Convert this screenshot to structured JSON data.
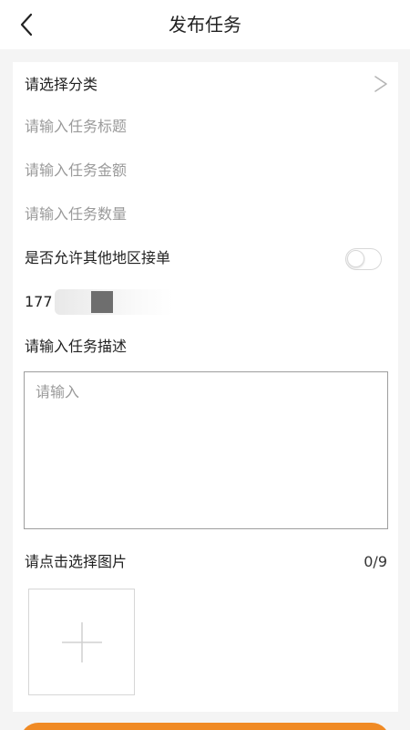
{
  "header": {
    "title": "发布任务",
    "back_icon": "chevron-left-icon"
  },
  "form": {
    "category_label": "请选择分类",
    "title_placeholder": "请输入任务标题",
    "amount_placeholder": "请输入任务金额",
    "quantity_placeholder": "请输入任务数量",
    "allow_other_regions_label": "是否允许其他地区接单",
    "allow_other_regions_enabled": false,
    "phone_prefix": "177",
    "description_label": "请输入任务描述",
    "description_placeholder": "请输入",
    "images_label": "请点击选择图片",
    "images_count": "0/9"
  },
  "colors": {
    "accent": "#f08a24",
    "placeholder": "#9a9a9a",
    "background": "#f4f4f4"
  }
}
